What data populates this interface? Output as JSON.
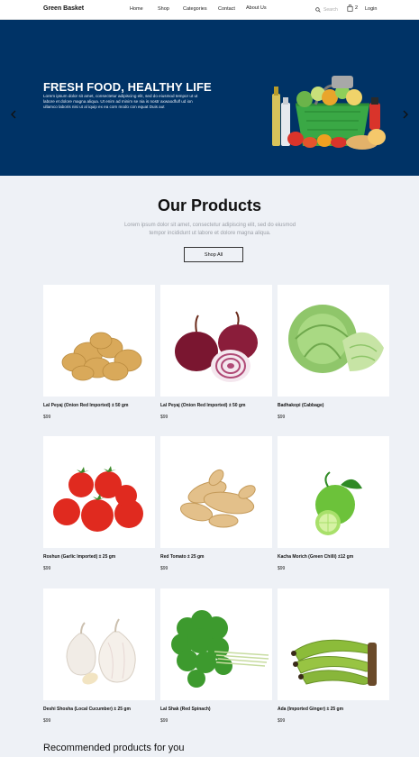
{
  "nav": {
    "brand": "Green Basket",
    "links": [
      "Home",
      "Shop",
      "Categories",
      "Contact",
      "About Us"
    ],
    "search_placeholder": "Search",
    "cart_count": "2",
    "login": "Login"
  },
  "hero": {
    "title": "FRESH FOOD, HEALTHY LIFE",
    "text": "Lorem ipsum dolor sit amet, consectetur adipiscing elit, sed do eiusmod tempor ut ut labore et dolore magna aliqua. Ut enim ad minim se nia  is nostr axwaodfulf ud ion ullamco laboris nisi ut al iquip ex ea com modo con  equat Duis aut",
    "bg_color": "#003366"
  },
  "products_section": {
    "title": "Our Products",
    "subtitle": "Lorem ipsum dolor sit amet, consectetur adipiscing elit, sed do eiusmod tempor incididunt ut labore et dolore magna aliqua.",
    "shop_all": "Shop All"
  },
  "products": [
    {
      "name": "Lal Peyaj (Onion Red Imported) ± 50 gm",
      "price": "$99",
      "image": "potatoes"
    },
    {
      "name": "Lal Peyaj (Onion Red Imported) ± 50 gm",
      "price": "$99",
      "image": "red-onions"
    },
    {
      "name": "Badhakopi (Cabbage)",
      "price": "$99",
      "image": "cabbage"
    },
    {
      "name": "Roshun (Garlic Imported) ± 25 gm",
      "price": "$99",
      "image": "tomatoes"
    },
    {
      "name": "Red Tomato ± 25 gm",
      "price": "$99",
      "image": "ginger"
    },
    {
      "name": "Kacha Morich (Green Chilli) ±12 gm",
      "price": "$99",
      "image": "limes"
    },
    {
      "name": "Deshi Shosha (Local Cucumber) ± 25 gm",
      "price": "$99",
      "image": "garlic"
    },
    {
      "name": "Lal Shak (Red Spinach)",
      "price": "$99",
      "image": "coriander"
    },
    {
      "name": "Ada (Imported Ginger) ± 25 gm",
      "price": "$99",
      "image": "green-bananas"
    }
  ],
  "recommended": {
    "title": "Recommended products for you"
  }
}
